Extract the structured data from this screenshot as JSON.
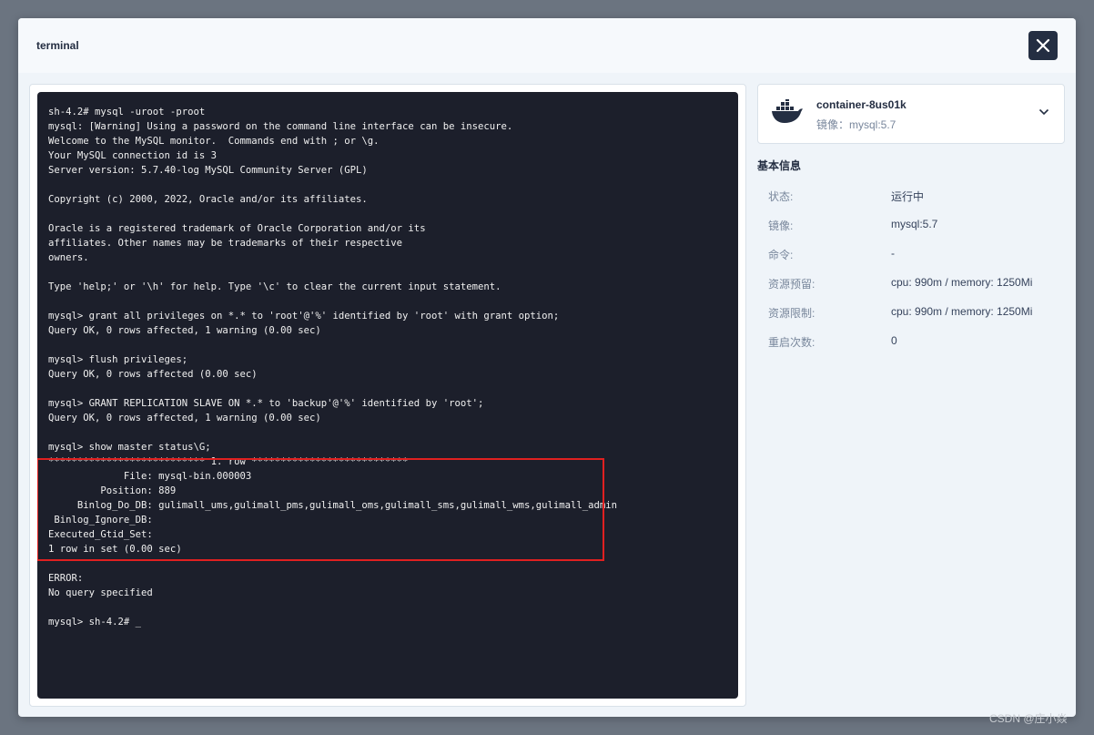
{
  "modal": {
    "title": "terminal"
  },
  "terminal": {
    "lines": [
      "sh-4.2# mysql -uroot -proot",
      "mysql: [Warning] Using a password on the command line interface can be insecure.",
      "Welcome to the MySQL monitor.  Commands end with ; or \\g.",
      "Your MySQL connection id is 3",
      "Server version: 5.7.40-log MySQL Community Server (GPL)",
      "",
      "Copyright (c) 2000, 2022, Oracle and/or its affiliates.",
      "",
      "Oracle is a registered trademark of Oracle Corporation and/or its",
      "affiliates. Other names may be trademarks of their respective",
      "owners.",
      "",
      "Type 'help;' or '\\h' for help. Type '\\c' to clear the current input statement.",
      "",
      "mysql> grant all privileges on *.* to 'root'@'%' identified by 'root' with grant option;",
      "Query OK, 0 rows affected, 1 warning (0.00 sec)",
      "",
      "mysql> flush privileges;",
      "Query OK, 0 rows affected (0.00 sec)",
      "",
      "mysql> GRANT REPLICATION SLAVE ON *.* to 'backup'@'%' identified by 'root';",
      "Query OK, 0 rows affected, 1 warning (0.00 sec)",
      "",
      "mysql> show master status\\G;",
      "*************************** 1. row ***************************",
      "             File: mysql-bin.000003",
      "         Position: 889",
      "     Binlog_Do_DB: gulimall_ums,gulimall_pms,gulimall_oms,gulimall_sms,gulimall_wms,gulimall_admin",
      " Binlog_Ignore_DB:",
      "Executed_Gtid_Set:",
      "1 row in set (0.00 sec)",
      "",
      "ERROR:",
      "No query specified",
      "",
      "mysql> sh-4.2# _"
    ]
  },
  "container": {
    "name": "container-8us01k",
    "image_label": "镜像：mysql:5.7"
  },
  "basic_info": {
    "title": "基本信息",
    "rows": [
      {
        "key": "状态:",
        "value": "运行中"
      },
      {
        "key": "镜像:",
        "value": "mysql:5.7"
      },
      {
        "key": "命令:",
        "value": "-"
      },
      {
        "key": "资源预留:",
        "value": "cpu: 990m / memory: 1250Mi"
      },
      {
        "key": "资源限制:",
        "value": "cpu: 990m / memory: 1250Mi"
      },
      {
        "key": "重启次数:",
        "value": "0"
      }
    ]
  },
  "watermark": "CSDN @庄小焱",
  "colors": {
    "accent": "#242e42",
    "terminal_bg": "#1c1f2b",
    "highlight": "#e02020"
  }
}
